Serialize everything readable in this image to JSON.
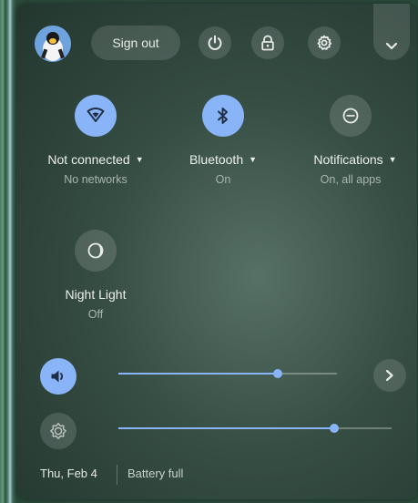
{
  "header": {
    "sign_out_label": "Sign out",
    "icons": [
      "avatar",
      "power-icon",
      "lock-icon",
      "settings-icon",
      "chevron-down-icon"
    ]
  },
  "features": [
    {
      "label": "Not connected",
      "sub": "No networks",
      "icon": "wifi-icon",
      "state": "on"
    },
    {
      "label": "Bluetooth",
      "sub": "On",
      "icon": "bluetooth-icon",
      "state": "on"
    },
    {
      "label": "Notifications",
      "sub": "On, all apps",
      "icon": "do-not-disturb-icon",
      "state": "off"
    },
    {
      "label": "Night Light",
      "sub": "Off",
      "icon": "night-light-icon",
      "state": "off"
    }
  ],
  "sliders": {
    "volume_level": 0.73,
    "brightness_level": 0.79
  },
  "footer": {
    "date": "Thu, Feb 4",
    "battery": "Battery full"
  },
  "colors": {
    "accent": "#8ab4f8",
    "panel": "#2f4a40"
  }
}
